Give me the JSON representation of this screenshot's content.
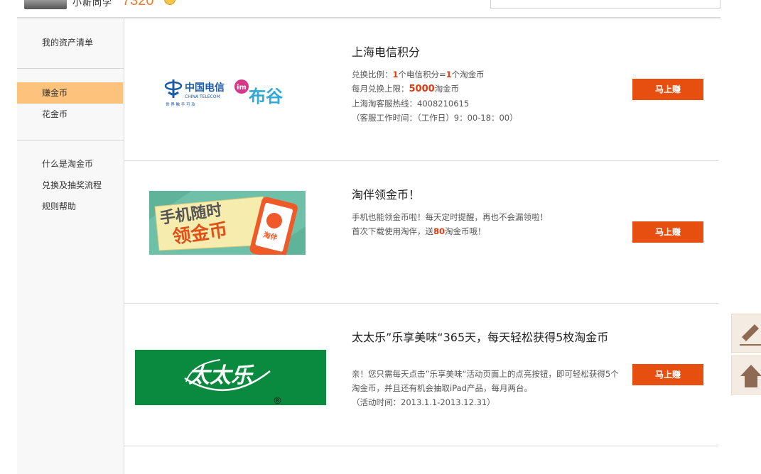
{
  "header": {
    "username": "小新同学",
    "coins": "7320"
  },
  "sidebar": {
    "group1": [
      "我的资产清单"
    ],
    "group2": [
      "赚金币",
      "花金币"
    ],
    "group3": [
      "什么是淘金币",
      "兑换及抽奖流程",
      "规则帮助"
    ]
  },
  "rows": [
    {
      "logo_text_a": "中国电信",
      "logo_text_a_en": "CHINA TELECOM",
      "logo_text_a_sub": "世 界 触 手 可 及",
      "logo_text_b_badge": "im",
      "logo_text_b": "布谷",
      "title": "上海电信积分",
      "line1_a": "兑换比例：",
      "line1_b": "1",
      "line1_c": "个电信积分=",
      "line1_d": "1",
      "line1_e": "个淘金币",
      "line2_a": "每月兑换上限：",
      "line2_b": "5000",
      "line2_c": "淘金币",
      "line3": "上海淘客服热线：4008210615",
      "line4": "（客服工作时间：（工作日）9：00-18：00）",
      "button": "马上赚"
    },
    {
      "banner_line1": "手机随时",
      "banner_line2": "领金币",
      "banner_app": "淘伴",
      "title": "淘伴领金币！",
      "line1": "手机也能领金币啦！每天定时提醒，再也不会漏领啦！",
      "line2_a": "首次下载使用淘伴，送",
      "line2_b": "80",
      "line2_c": "淘金币哦！",
      "button": "马上赚"
    },
    {
      "brand": "太太乐",
      "reg": "®",
      "title": "太太乐”乐享美味“365天，每天轻松获得5枚淘金币",
      "line1": "亲！您只需每天点击”乐享美味“活动页面上的点亮按钮，即可轻松获得5个淘金币，并且还有机会抽取iPad产品，每月两台。",
      "line2": "（活动时间：2013.1.1-2013.12.31）",
      "button": "马上赚"
    }
  ],
  "tools": [
    "pencil-icon",
    "back-to-top-icon"
  ],
  "colors": {
    "accent": "#e64f0f",
    "active_nav": "#fdc27b",
    "highlight": "#e03a10"
  }
}
